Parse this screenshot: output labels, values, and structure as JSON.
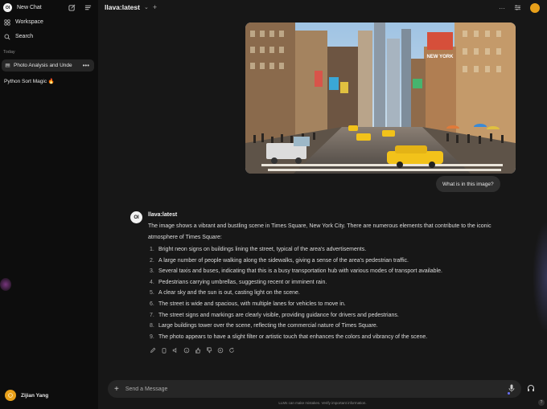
{
  "sidebar": {
    "new_chat_label": "New Chat",
    "logo_text": "OI",
    "workspace_label": "Workspace",
    "search_label": "Search",
    "section_today": "Today",
    "chats": [
      {
        "title": "Photo Analysis and Unde",
        "active": true
      },
      {
        "title": "Python Sort Magic 🔥",
        "active": false
      }
    ],
    "user_name": "Zijian Yang"
  },
  "header": {
    "model_name": "llava:latest"
  },
  "conversation": {
    "user_message": "What is in this image?",
    "bot_logo_text": "OI",
    "bot_name": "llava:latest",
    "bot_intro": "The image shows a vibrant and bustling scene in Times Square, New York City. There are numerous elements that contribute to the iconic atmosphere of Times Square:",
    "bot_points": [
      {
        "num": "1.",
        "text": "Bright neon signs on buildings lining the street, typical of the area's advertisements."
      },
      {
        "num": "2.",
        "text": "A large number of people walking along the sidewalks, giving a sense of the area's pedestrian traffic."
      },
      {
        "num": "3.",
        "text": "Several taxis and buses, indicating that this is a busy transportation hub with various modes of transport available."
      },
      {
        "num": "4.",
        "text": "Pedestrians carrying umbrellas, suggesting recent or imminent rain."
      },
      {
        "num": "5.",
        "text": "A clear sky and the sun is out, casting light on the scene."
      },
      {
        "num": "6.",
        "text": "The street is wide and spacious, with multiple lanes for vehicles to move in."
      },
      {
        "num": "7.",
        "text": "The street signs and markings are clearly visible, providing guidance for drivers and pedestrians."
      },
      {
        "num": "8.",
        "text": "Large buildings tower over the scene, reflecting the commercial nature of Times Square."
      },
      {
        "num": "9.",
        "text": "The photo appears to have a slight filter or artistic touch that enhances the colors and vibrancy of the scene."
      }
    ]
  },
  "image": {
    "sign_text": "NEW YORK"
  },
  "composer": {
    "placeholder": "Send a Message"
  },
  "footer": {
    "disclaimer": "LLMs can make mistakes. Verify important information.",
    "help": "?"
  },
  "colors": {
    "sidebar_bg": "#0d0d0d",
    "main_bg": "#171717",
    "avatar": "#e8a01a",
    "taxi_yellow": "#f2c21a"
  }
}
